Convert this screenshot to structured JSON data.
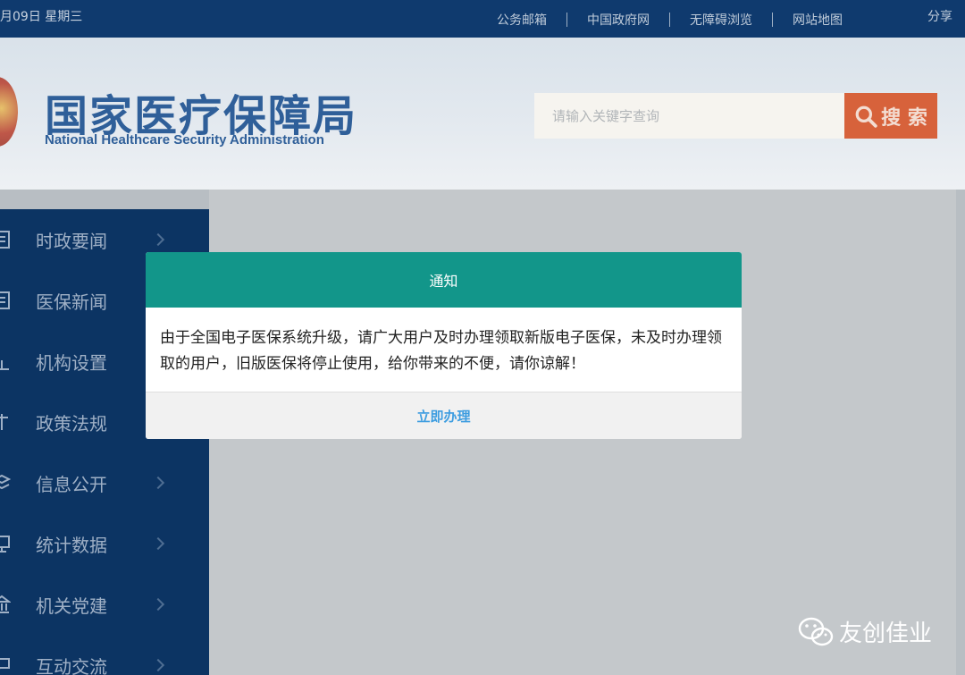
{
  "topbar": {
    "date": "月09日 星期三",
    "links": [
      "公务邮箱",
      "中国政府网",
      "无障碍浏览",
      "网站地图"
    ],
    "share": "分享"
  },
  "header": {
    "title_cn": "国家医疗保障局",
    "title_en": "National Healthcare Security Administration",
    "search_placeholder": "请输入关键字查询",
    "search_button": "搜 索"
  },
  "sidebar": {
    "items": [
      {
        "label": "时政要闻",
        "icon": "document-icon"
      },
      {
        "label": "医保新闻",
        "icon": "news-icon"
      },
      {
        "label": "机构设置",
        "icon": "chart-icon"
      },
      {
        "label": "政策法规",
        "icon": "scales-icon"
      },
      {
        "label": "信息公开",
        "icon": "layers-icon"
      },
      {
        "label": "统计数据",
        "icon": "monitor-icon"
      },
      {
        "label": "机关党建",
        "icon": "building-icon"
      },
      {
        "label": "互动交流",
        "icon": "chat-icon"
      }
    ]
  },
  "modal": {
    "title": "通知",
    "message": "由于全国电子医保系统升级，请广大用户及时办理领取新版电子医保，未及时办理领取的用户，旧版医保将停止使用，给你带来的不便，请你谅解！",
    "action": "立即办理"
  },
  "watermark": {
    "text": "友创佳业",
    "icon": "wechat-icon"
  },
  "colors": {
    "topbar": "#0f3a6e",
    "sidebar": "#0c3463",
    "modal_header": "#12968a",
    "search_button": "#d7623b",
    "action_link": "#3d9de0"
  }
}
